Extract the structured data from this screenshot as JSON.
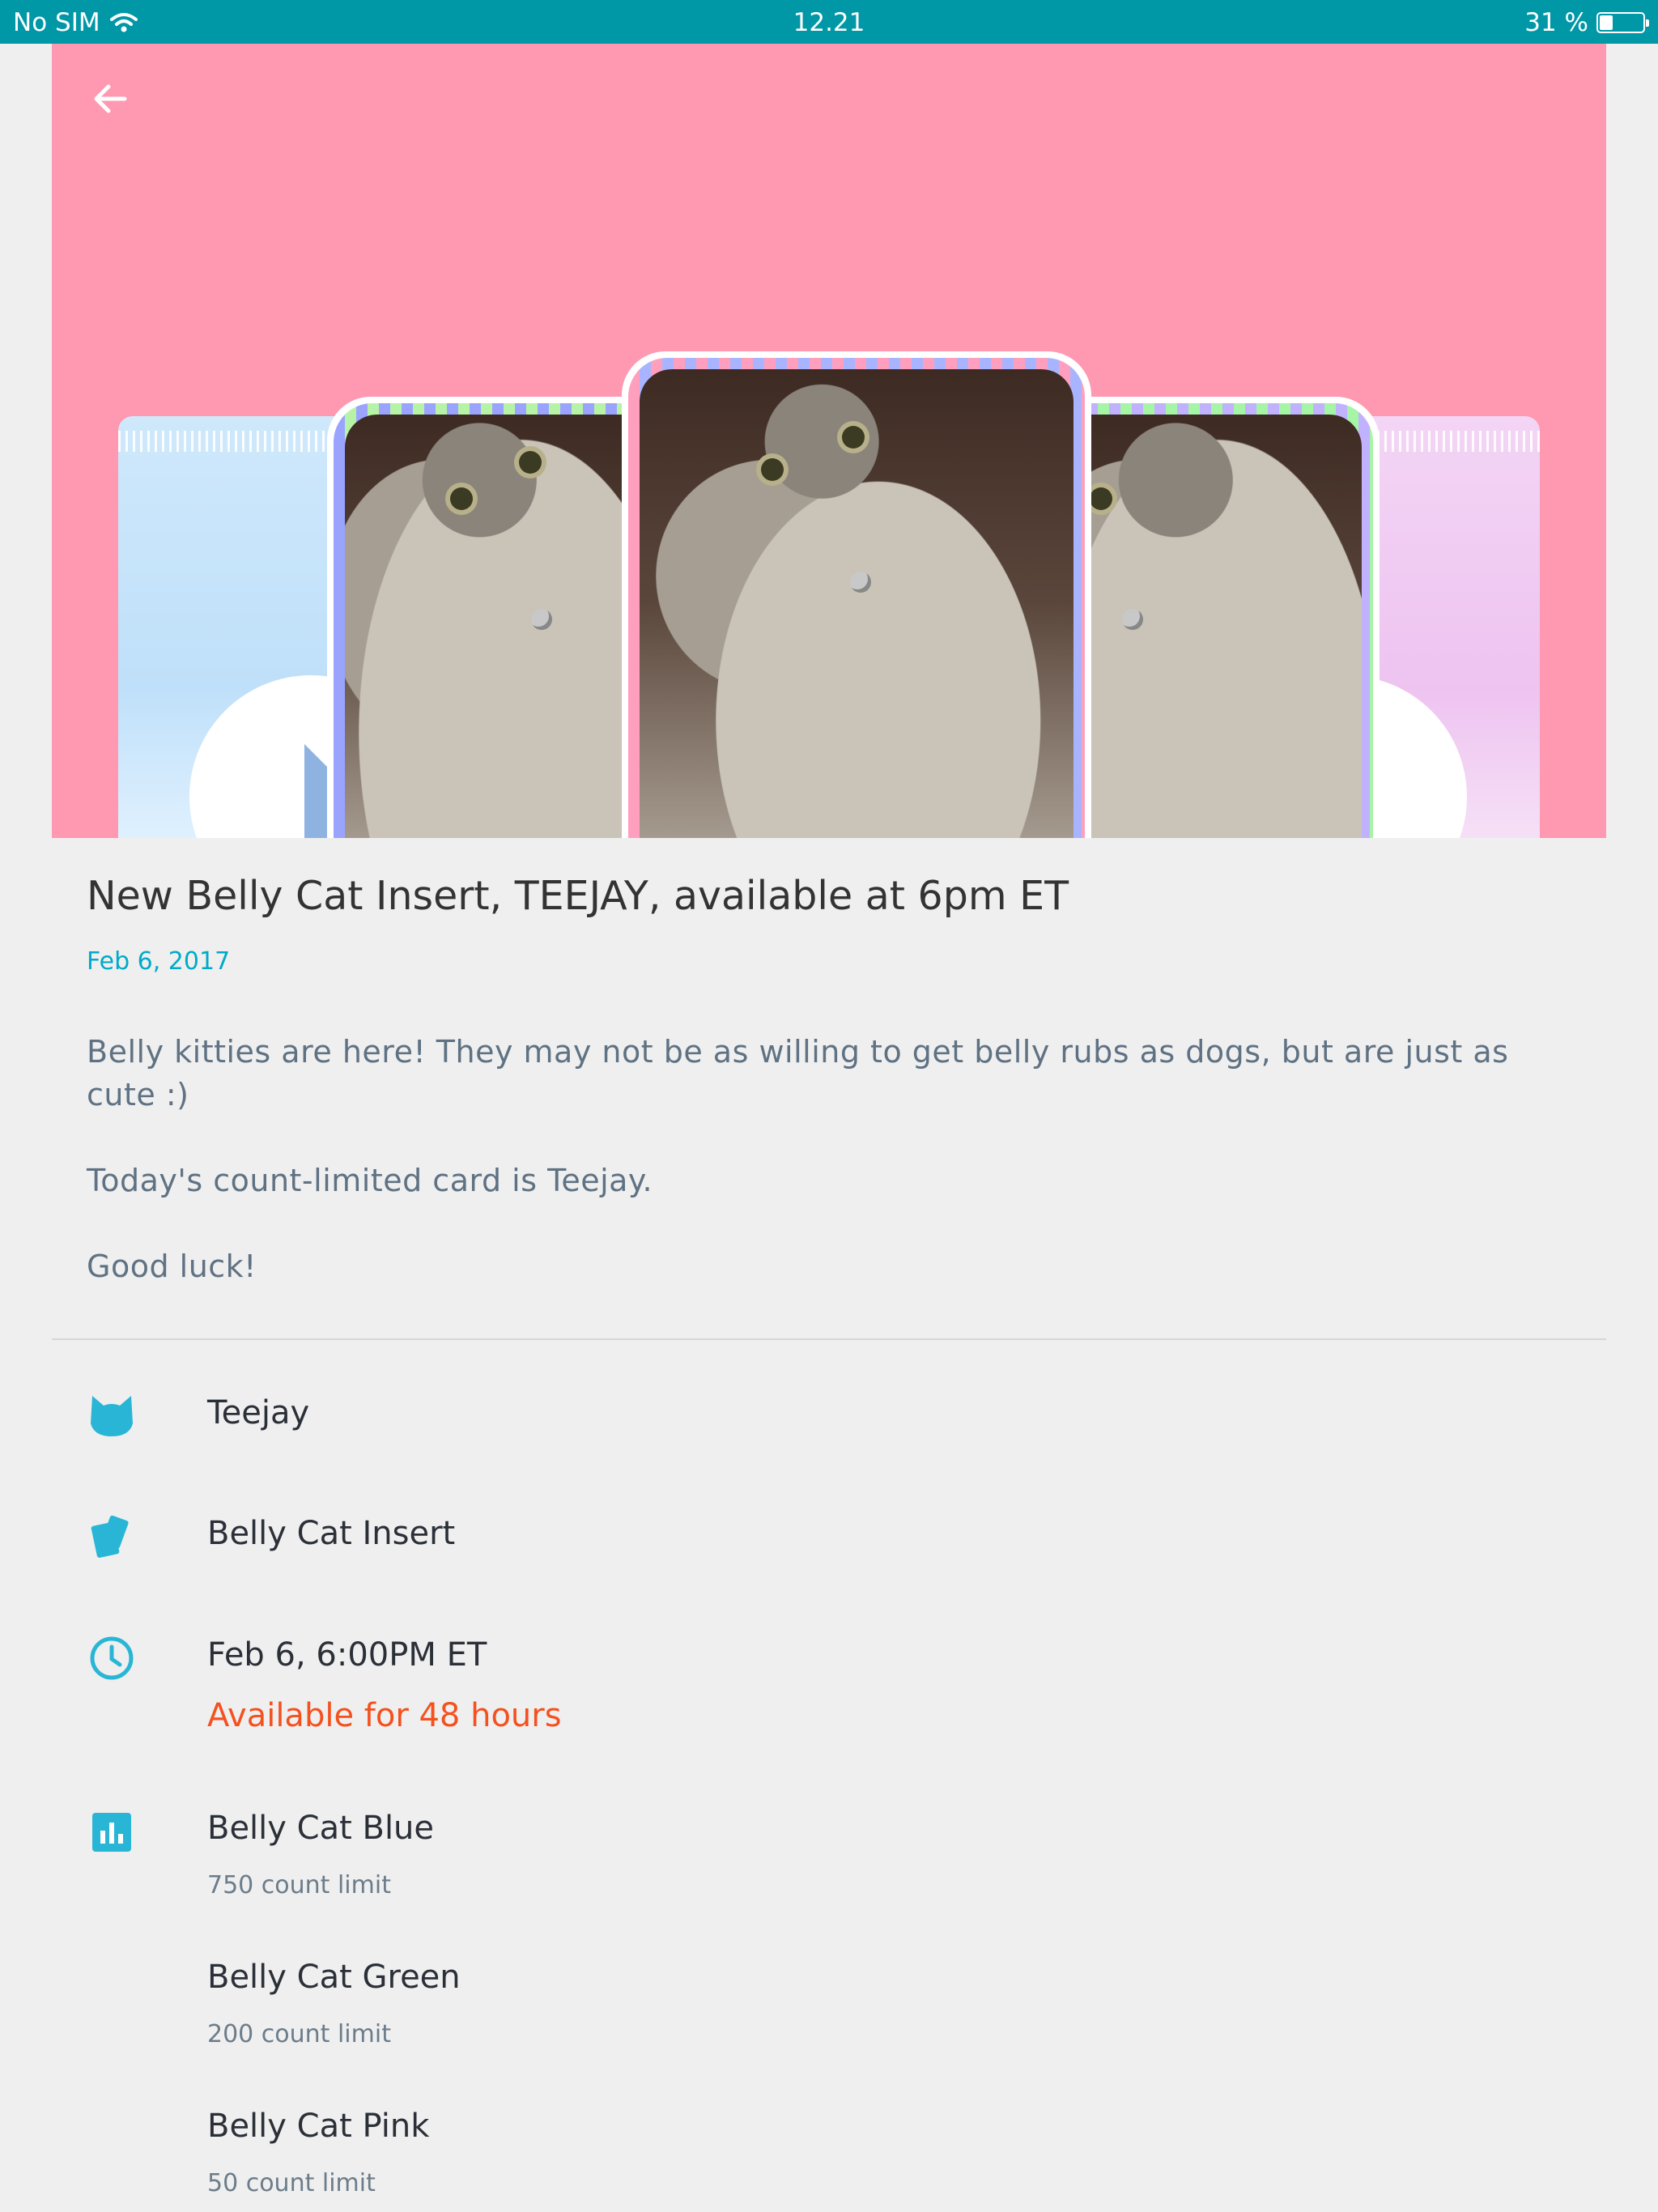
{
  "status_bar": {
    "carrier": "No SIM",
    "time": "12.21",
    "battery_text": "31 %",
    "battery_level": 0.31
  },
  "colors": {
    "status_bar": "#0097a7",
    "hero_background": "#ff98b1",
    "accent": "#00aac9",
    "warning": "#f4511e"
  },
  "post": {
    "title": "New Belly Cat Insert, TEEJAY, available at 6pm ET",
    "date": "Feb 6, 2017",
    "paragraphs": [
      "Belly kitties are here! They may not be as willing to get belly rubs as dogs, but are just as cute :)",
      "Today's count-limited card is Teejay.",
      "Good luck!"
    ]
  },
  "details": {
    "card_name": {
      "icon": "cat-icon",
      "label": "Teejay"
    },
    "set_name": {
      "icon": "cards-icon",
      "label": "Belly Cat Insert"
    },
    "release": {
      "icon": "clock-icon",
      "label": "Feb 6, 6:00PM ET",
      "availability": "Available for 48 hours"
    },
    "limits": {
      "icon": "bar-chart-icon",
      "items": [
        {
          "name": "Belly Cat Blue",
          "limit": "750 count limit"
        },
        {
          "name": "Belly Cat Green",
          "limit": "200 count limit"
        },
        {
          "name": "Belly Cat Pink",
          "limit": "50 count limit"
        }
      ]
    }
  }
}
